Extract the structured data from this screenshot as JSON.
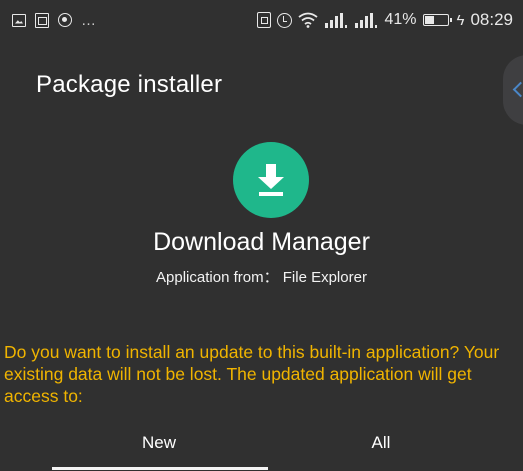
{
  "status_bar": {
    "more": "…",
    "battery_percent": "41%",
    "bolt": "ϟ",
    "time": "08:29"
  },
  "page_title": "Package installer",
  "app": {
    "name": "Download Manager",
    "source": "Application from： File Explorer",
    "icon_color": "#1fb78b"
  },
  "message": "Do you want to install an update to this built-in application? Your existing data will not be lost. The updated application will get access to:",
  "tabs": [
    {
      "label": "New"
    },
    {
      "label": "All"
    }
  ],
  "colors": {
    "background": "#303030",
    "warning_text": "#f0b400"
  }
}
